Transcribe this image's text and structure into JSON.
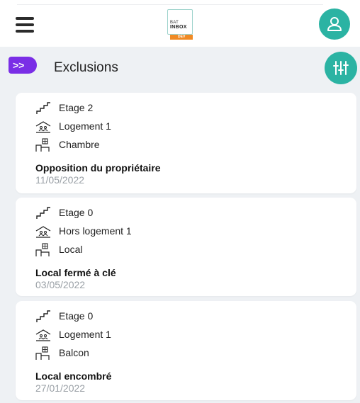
{
  "header": {
    "logo": {
      "line1": "BAT",
      "line2": "INBOX",
      "badge": "DEV"
    }
  },
  "page": {
    "expand_label": ">>",
    "title": "Exclusions"
  },
  "exclusions": [
    {
      "etage": "Etage 2",
      "logement": "Logement 1",
      "piece": "Chambre",
      "motif": "Opposition du propriétaire",
      "date": "11/05/2022"
    },
    {
      "etage": "Etage 0",
      "logement": "Hors logement 1",
      "piece": "Local",
      "motif": "Local fermé à clé",
      "date": "03/05/2022"
    },
    {
      "etage": "Etage 0",
      "logement": "Logement 1",
      "piece": "Balcon",
      "motif": "Local encombré",
      "date": "27/01/2022"
    }
  ],
  "colors": {
    "accent": "#2bb3a3",
    "tab": "#7a2ee6",
    "logo_badge": "#f08a24",
    "background": "#eef1f4"
  },
  "icons": [
    "menu-icon",
    "user-icon",
    "filter-sliders-icon",
    "stairs-icon",
    "housing-icon",
    "room-icon"
  ]
}
